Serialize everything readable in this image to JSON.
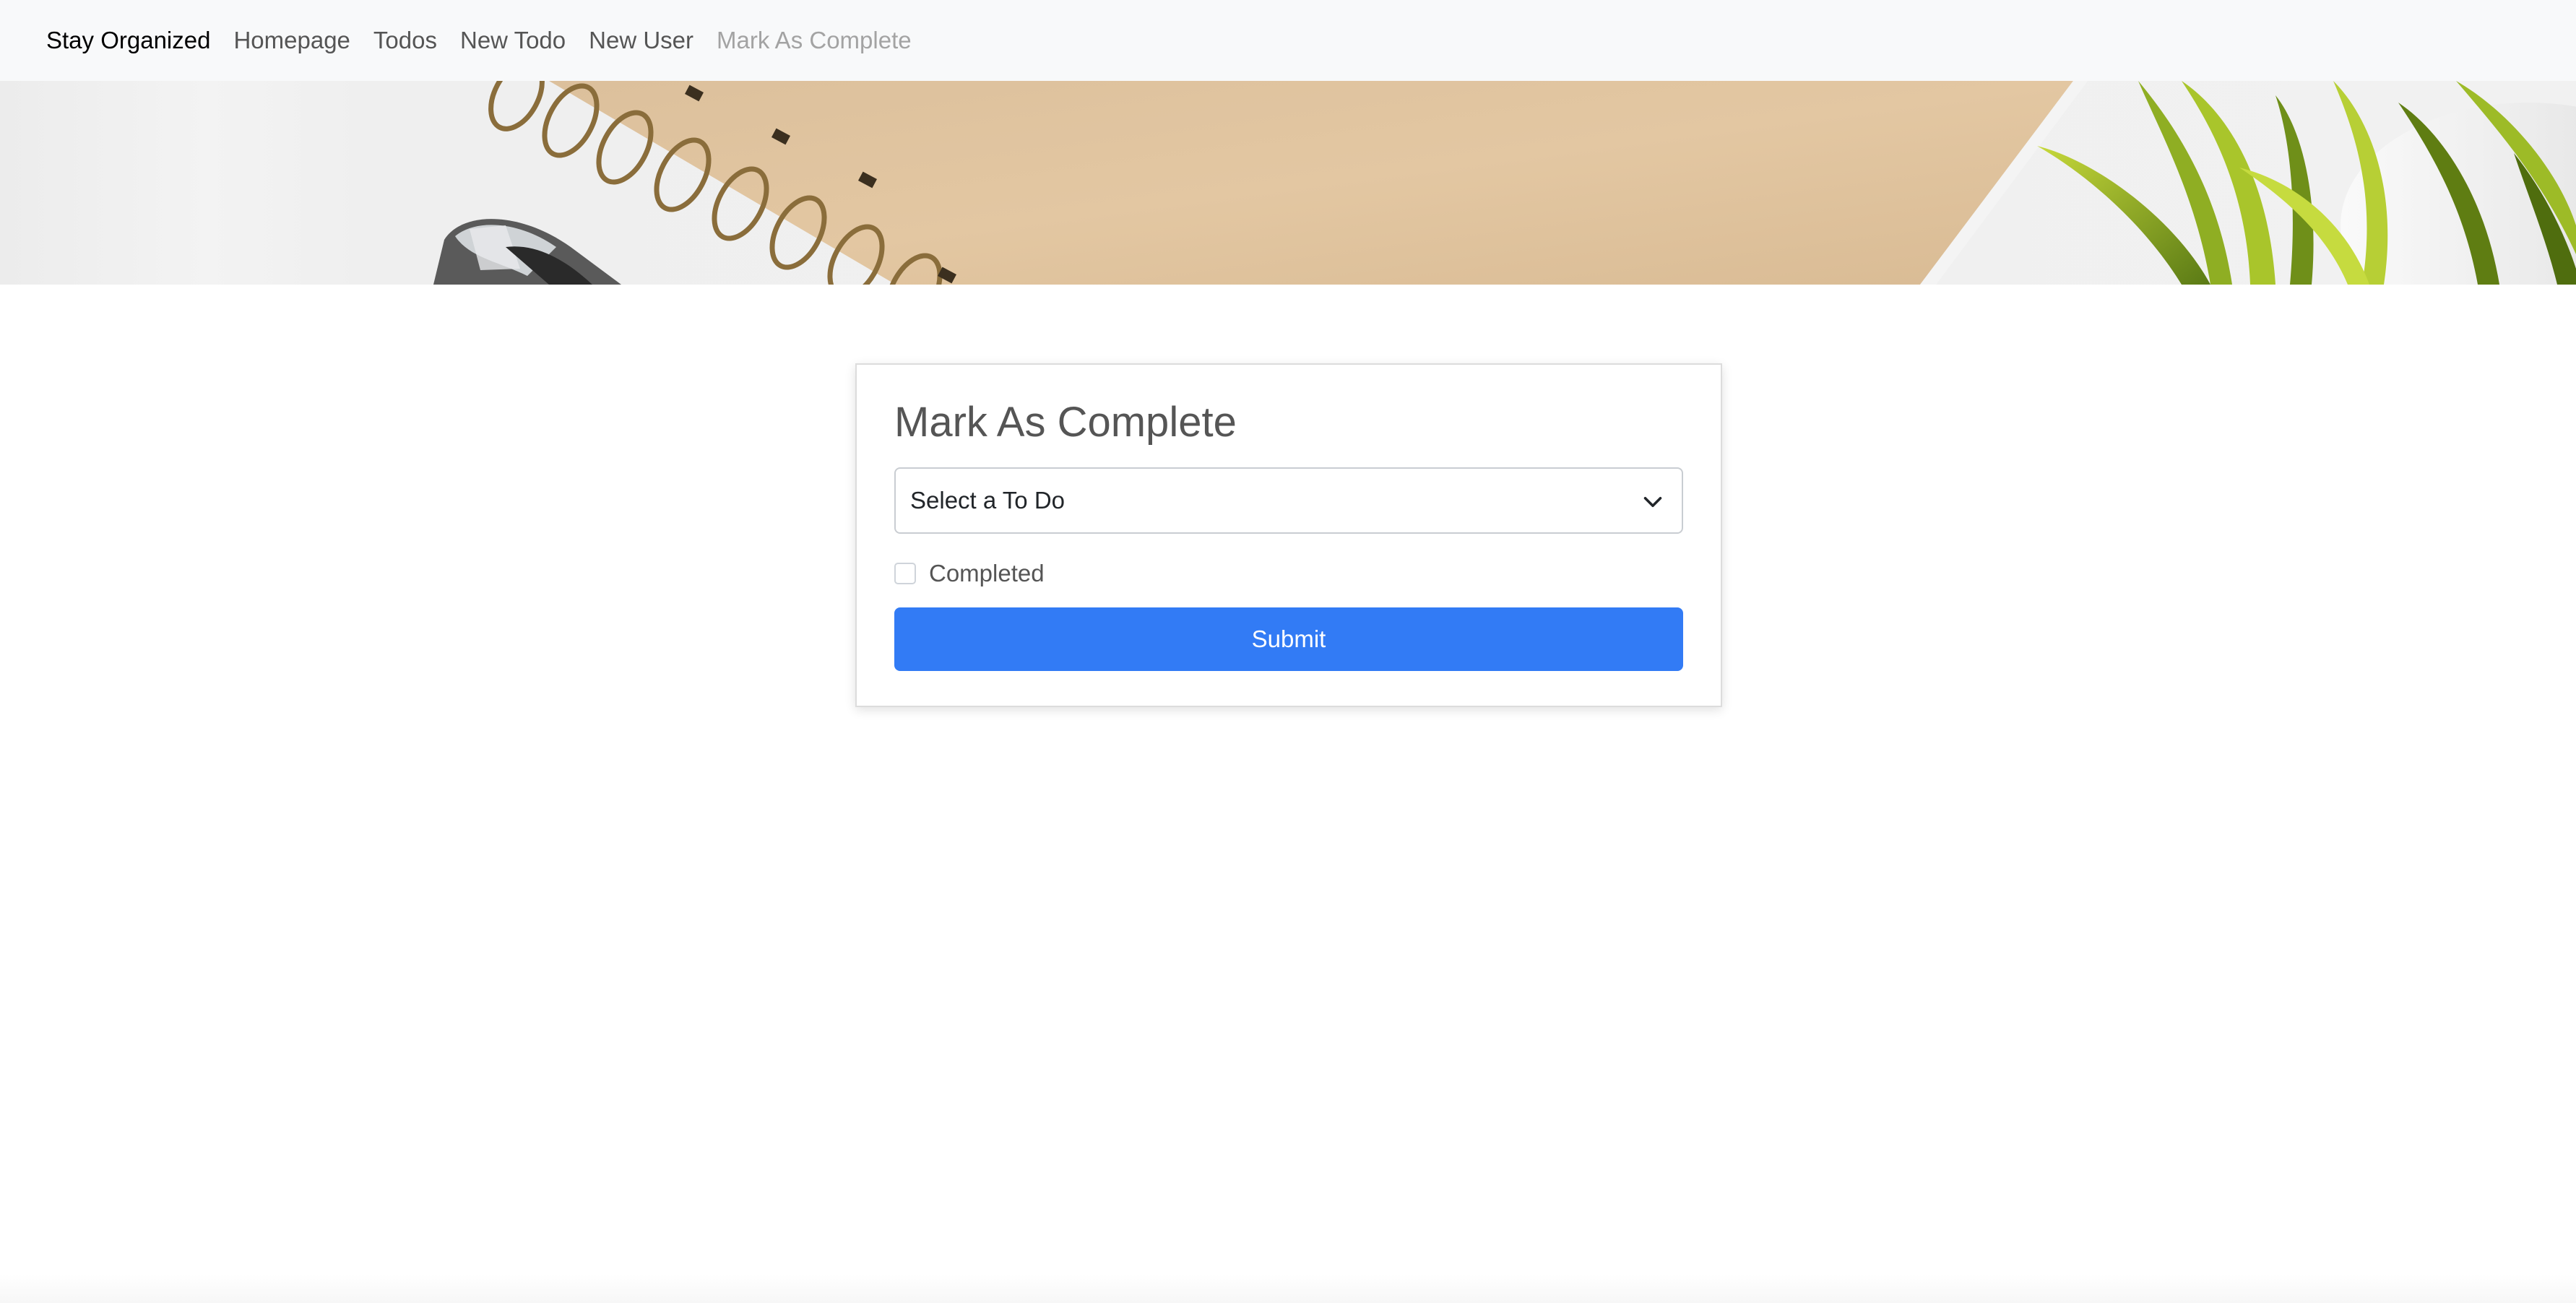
{
  "navbar": {
    "brand": "Stay Organized",
    "links": [
      {
        "label": "Homepage",
        "active": false
      },
      {
        "label": "Todos",
        "active": false
      },
      {
        "label": "New Todo",
        "active": false
      },
      {
        "label": "New User",
        "active": false
      },
      {
        "label": "Mark As Complete",
        "active": true
      }
    ]
  },
  "hero": {
    "icons": [
      "spiral-notebook-image",
      "pen-image",
      "plant-image"
    ]
  },
  "form": {
    "title": "Mark As Complete",
    "select": {
      "selected": "Select a To Do",
      "icon": "chevron-down-icon"
    },
    "checkbox": {
      "label": "Completed",
      "checked": false
    },
    "submit_label": "Submit"
  },
  "colors": {
    "navbar_bg": "#f8f9fa",
    "brand_text": "#000000",
    "nav_text": "#555555",
    "nav_active_text": "#a3a3a3",
    "primary_button": "#327bf5",
    "card_title": "#555555"
  }
}
